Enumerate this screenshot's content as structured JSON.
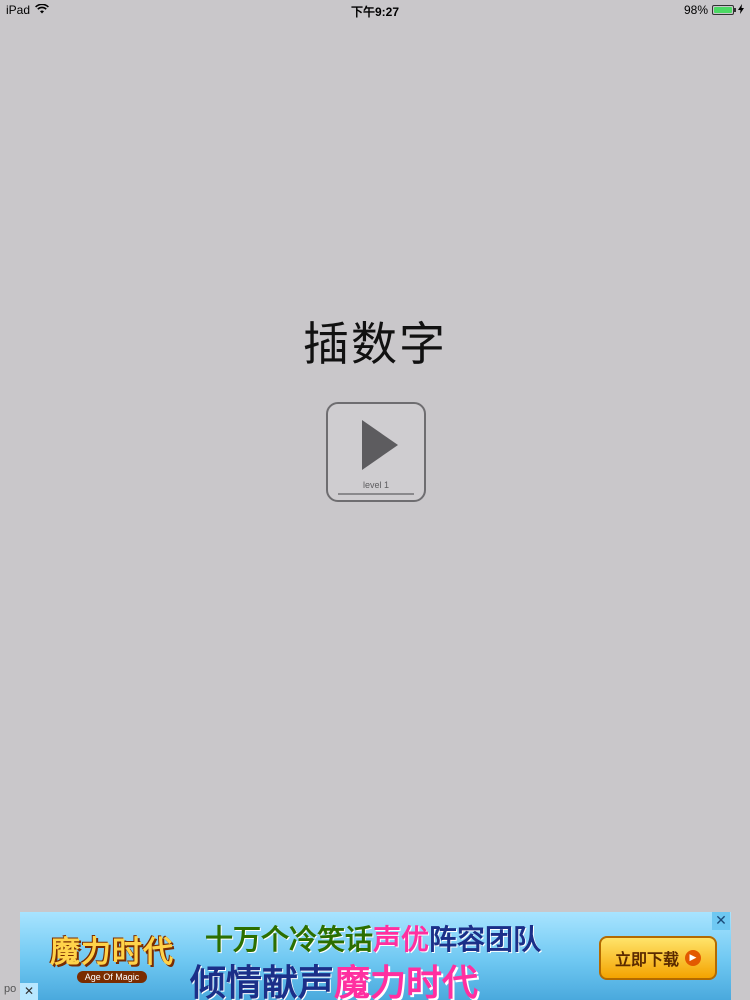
{
  "status_bar": {
    "device": "iPad",
    "wifi_icon": "wifi-icon",
    "time": "下午9:27",
    "battery_percent": "98%",
    "battery_level": 0.98,
    "battery_color": "#4cd964",
    "charging_icon": "bolt-icon"
  },
  "main": {
    "title": "插数字",
    "play_button": {
      "icon": "play-icon",
      "level_label": "level 1"
    }
  },
  "ad": {
    "logo_text": "魔力时代",
    "logo_subtitle": "Age Of Magic",
    "line1_part1": "十万个冷笑话",
    "line1_part2": "声优",
    "line1_part3": "阵容团队",
    "line2_part1": "倾情献声",
    "line2_part2": "魔力时代",
    "download_label": "立即下载",
    "close_icon": "close-icon",
    "provider_label": "po"
  }
}
